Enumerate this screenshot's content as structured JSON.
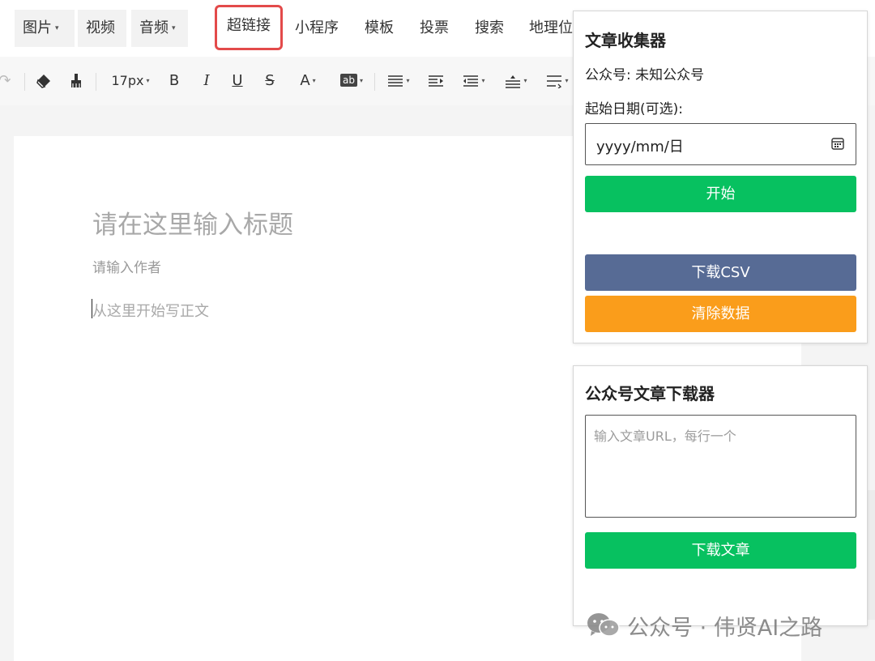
{
  "menu": {
    "items": [
      {
        "label": "图片",
        "caret": "▾"
      },
      {
        "label": "视频"
      },
      {
        "label": "音频",
        "caret": "▾"
      },
      {
        "label": "超链接"
      },
      {
        "label": "小程序"
      },
      {
        "label": "模板"
      },
      {
        "label": "投票"
      },
      {
        "label": "搜索"
      },
      {
        "label": "地理位"
      }
    ],
    "highlight_color": "#e34a4a"
  },
  "toolbar": {
    "redo": "↷",
    "font_size": "17px",
    "bold": "B",
    "italic": "I",
    "underline": "U",
    "strike": "S",
    "font_color": "A",
    "bg_color": "ab",
    "caret": "▾"
  },
  "editor": {
    "title_placeholder": "请在这里输入标题",
    "author_placeholder": "请输入作者",
    "body_placeholder": "从这里开始写正文"
  },
  "collector": {
    "title": "文章收集器",
    "account_label": "公众号: 未知公众号",
    "start_date_label": "起始日期(可选):",
    "date_value": "yyyy/mm/日",
    "start_button": "开始",
    "download_csv_button": "下载CSV",
    "clear_button": "清除数据"
  },
  "downloader": {
    "title": "公众号文章下载器",
    "url_placeholder": "输入文章URL，每行一个",
    "download_button": "下载文章"
  },
  "watermark": {
    "text": "公众号 · 伟贤AI之路"
  },
  "colors": {
    "green": "#07c160",
    "slate": "#576b95",
    "orange": "#fa9d1b"
  }
}
